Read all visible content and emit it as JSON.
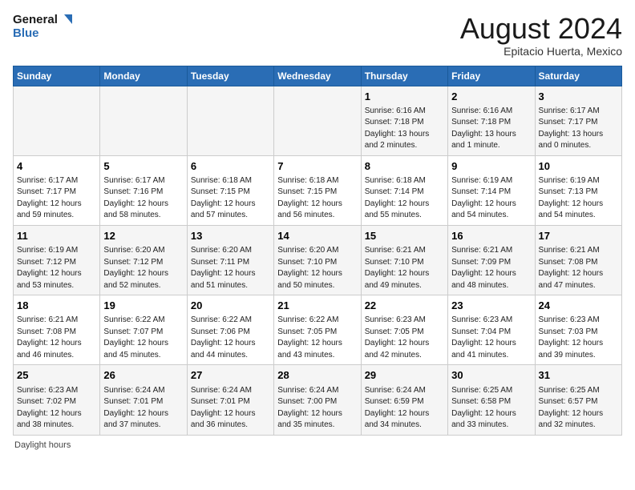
{
  "header": {
    "logo_general": "General",
    "logo_blue": "Blue",
    "main_title": "August 2024",
    "subtitle": "Epitacio Huerta, Mexico"
  },
  "columns": [
    "Sunday",
    "Monday",
    "Tuesday",
    "Wednesday",
    "Thursday",
    "Friday",
    "Saturday"
  ],
  "weeks": [
    {
      "days": [
        {
          "num": "",
          "info": ""
        },
        {
          "num": "",
          "info": ""
        },
        {
          "num": "",
          "info": ""
        },
        {
          "num": "",
          "info": ""
        },
        {
          "num": "1",
          "info": "Sunrise: 6:16 AM\nSunset: 7:18 PM\nDaylight: 13 hours\nand 2 minutes."
        },
        {
          "num": "2",
          "info": "Sunrise: 6:16 AM\nSunset: 7:18 PM\nDaylight: 13 hours\nand 1 minute."
        },
        {
          "num": "3",
          "info": "Sunrise: 6:17 AM\nSunset: 7:17 PM\nDaylight: 13 hours\nand 0 minutes."
        }
      ]
    },
    {
      "days": [
        {
          "num": "4",
          "info": "Sunrise: 6:17 AM\nSunset: 7:17 PM\nDaylight: 12 hours\nand 59 minutes."
        },
        {
          "num": "5",
          "info": "Sunrise: 6:17 AM\nSunset: 7:16 PM\nDaylight: 12 hours\nand 58 minutes."
        },
        {
          "num": "6",
          "info": "Sunrise: 6:18 AM\nSunset: 7:15 PM\nDaylight: 12 hours\nand 57 minutes."
        },
        {
          "num": "7",
          "info": "Sunrise: 6:18 AM\nSunset: 7:15 PM\nDaylight: 12 hours\nand 56 minutes."
        },
        {
          "num": "8",
          "info": "Sunrise: 6:18 AM\nSunset: 7:14 PM\nDaylight: 12 hours\nand 55 minutes."
        },
        {
          "num": "9",
          "info": "Sunrise: 6:19 AM\nSunset: 7:14 PM\nDaylight: 12 hours\nand 54 minutes."
        },
        {
          "num": "10",
          "info": "Sunrise: 6:19 AM\nSunset: 7:13 PM\nDaylight: 12 hours\nand 54 minutes."
        }
      ]
    },
    {
      "days": [
        {
          "num": "11",
          "info": "Sunrise: 6:19 AM\nSunset: 7:12 PM\nDaylight: 12 hours\nand 53 minutes."
        },
        {
          "num": "12",
          "info": "Sunrise: 6:20 AM\nSunset: 7:12 PM\nDaylight: 12 hours\nand 52 minutes."
        },
        {
          "num": "13",
          "info": "Sunrise: 6:20 AM\nSunset: 7:11 PM\nDaylight: 12 hours\nand 51 minutes."
        },
        {
          "num": "14",
          "info": "Sunrise: 6:20 AM\nSunset: 7:10 PM\nDaylight: 12 hours\nand 50 minutes."
        },
        {
          "num": "15",
          "info": "Sunrise: 6:21 AM\nSunset: 7:10 PM\nDaylight: 12 hours\nand 49 minutes."
        },
        {
          "num": "16",
          "info": "Sunrise: 6:21 AM\nSunset: 7:09 PM\nDaylight: 12 hours\nand 48 minutes."
        },
        {
          "num": "17",
          "info": "Sunrise: 6:21 AM\nSunset: 7:08 PM\nDaylight: 12 hours\nand 47 minutes."
        }
      ]
    },
    {
      "days": [
        {
          "num": "18",
          "info": "Sunrise: 6:21 AM\nSunset: 7:08 PM\nDaylight: 12 hours\nand 46 minutes."
        },
        {
          "num": "19",
          "info": "Sunrise: 6:22 AM\nSunset: 7:07 PM\nDaylight: 12 hours\nand 45 minutes."
        },
        {
          "num": "20",
          "info": "Sunrise: 6:22 AM\nSunset: 7:06 PM\nDaylight: 12 hours\nand 44 minutes."
        },
        {
          "num": "21",
          "info": "Sunrise: 6:22 AM\nSunset: 7:05 PM\nDaylight: 12 hours\nand 43 minutes."
        },
        {
          "num": "22",
          "info": "Sunrise: 6:23 AM\nSunset: 7:05 PM\nDaylight: 12 hours\nand 42 minutes."
        },
        {
          "num": "23",
          "info": "Sunrise: 6:23 AM\nSunset: 7:04 PM\nDaylight: 12 hours\nand 41 minutes."
        },
        {
          "num": "24",
          "info": "Sunrise: 6:23 AM\nSunset: 7:03 PM\nDaylight: 12 hours\nand 39 minutes."
        }
      ]
    },
    {
      "days": [
        {
          "num": "25",
          "info": "Sunrise: 6:23 AM\nSunset: 7:02 PM\nDaylight: 12 hours\nand 38 minutes."
        },
        {
          "num": "26",
          "info": "Sunrise: 6:24 AM\nSunset: 7:01 PM\nDaylight: 12 hours\nand 37 minutes."
        },
        {
          "num": "27",
          "info": "Sunrise: 6:24 AM\nSunset: 7:01 PM\nDaylight: 12 hours\nand 36 minutes."
        },
        {
          "num": "28",
          "info": "Sunrise: 6:24 AM\nSunset: 7:00 PM\nDaylight: 12 hours\nand 35 minutes."
        },
        {
          "num": "29",
          "info": "Sunrise: 6:24 AM\nSunset: 6:59 PM\nDaylight: 12 hours\nand 34 minutes."
        },
        {
          "num": "30",
          "info": "Sunrise: 6:25 AM\nSunset: 6:58 PM\nDaylight: 12 hours\nand 33 minutes."
        },
        {
          "num": "31",
          "info": "Sunrise: 6:25 AM\nSunset: 6:57 PM\nDaylight: 12 hours\nand 32 minutes."
        }
      ]
    }
  ],
  "footer": "Daylight hours"
}
